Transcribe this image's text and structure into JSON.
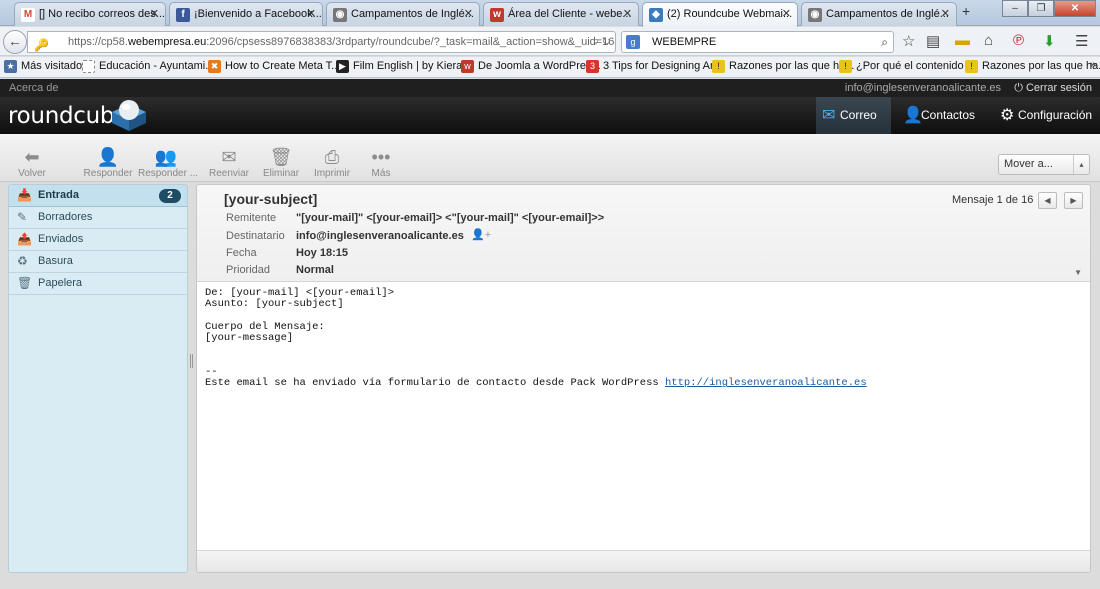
{
  "browser": {
    "tabs": [
      {
        "label": "[] No recibo correos des...",
        "favicon": "M",
        "fav_color": "#d14836"
      },
      {
        "label": "¡Bienvenido a Facebook...",
        "favicon": "f",
        "fav_color": "#3b5998"
      },
      {
        "label": "Campamentos de Inglé...",
        "favicon": "◉",
        "fav_color": "#666666"
      },
      {
        "label": "Área del Cliente - webe...",
        "favicon": "w",
        "fav_color": "#c0392b"
      },
      {
        "label": "(2) Roundcube Webmai...",
        "favicon": "◆",
        "fav_color": "#3a7bbf"
      },
      {
        "label": "Campamentos de Inglé...",
        "favicon": "◉",
        "fav_color": "#666666"
      }
    ],
    "url_prefix": "https://cp58.",
    "url_domain": "webempresa.eu",
    "url_rest": ":2096/cpsess8976838383/3rdparty/roundcube/?_task=mail&_action=show&_uid=16&_mbo:",
    "search_value": "WEBEMPRE",
    "bookmarks": [
      {
        "label": "Más visitados",
        "icon": "★",
        "color": "#4a6fa5"
      },
      {
        "label": "Educación - Ayuntami...",
        "icon": "□",
        "color": "#888888"
      },
      {
        "label": "How to Create Meta T...",
        "icon": "✖",
        "color": "#e87a1e"
      },
      {
        "label": "Film English | by Kiera...",
        "icon": "▶",
        "color": "#222222"
      },
      {
        "label": "De Joomla a WordPres...",
        "icon": "w",
        "color": "#c0392b"
      },
      {
        "label": "3 Tips for Designing Ar...",
        "icon": "3",
        "color": "#d9342b"
      },
      {
        "label": "Razones por las que ha...",
        "icon": "!",
        "color": "#e8c31a"
      },
      {
        "label": "¿Por qué el contenido ...",
        "icon": "!",
        "color": "#e8c31a"
      },
      {
        "label": "Razones por las que ha...",
        "icon": "!",
        "color": "#e8c31a"
      }
    ]
  },
  "roundcube": {
    "about": "Acerca de",
    "user_email": "info@inglesenveranoalicante.es",
    "logout": "Cerrar sesión",
    "logo": "roundcube",
    "nav": {
      "mail": "Correo",
      "contacts": "Contactos",
      "settings": "Configuración"
    },
    "toolbar": {
      "back": "Volver",
      "reply": "Responder",
      "reply_all": "Responder ...",
      "forward": "Reenviar",
      "delete": "Eliminar",
      "print": "Imprimir",
      "more": "Más",
      "move_to": "Mover a..."
    },
    "folders": [
      {
        "label": "Entrada",
        "icon": "inbox-icon",
        "unread": "2"
      },
      {
        "label": "Borradores",
        "icon": "pencil-icon"
      },
      {
        "label": "Enviados",
        "icon": "sent-icon"
      },
      {
        "label": "Basura",
        "icon": "junk-icon"
      },
      {
        "label": "Papelera",
        "icon": "trash-icon"
      }
    ],
    "message": {
      "subject": "[your-subject]",
      "counter": "Mensaje 1 de 16",
      "labels": {
        "from": "Remitente",
        "to": "Destinatario",
        "date": "Fecha",
        "priority": "Prioridad"
      },
      "from": "\"[your-mail]\" <[your-email]> <\"[your-mail]\" <[your-email]>>",
      "to": "info@inglesenveranoalicante.es",
      "date": "Hoy 18:15",
      "priority": "Normal",
      "body_text": "De: [your-mail] <[your-email]>\nAsunto: [your-subject]\n\nCuerpo del Mensaje:\n[your-message]\n\n\n--\nEste email se ha enviado vía formulario de contacto desde Pack WordPress ",
      "body_link": "http://inglesenveranoalicante.es"
    }
  }
}
